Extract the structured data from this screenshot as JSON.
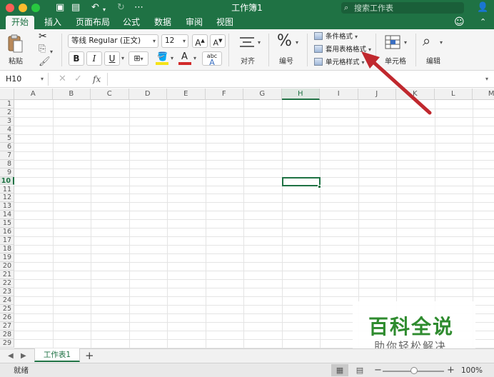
{
  "window": {
    "title": "工作簿1",
    "search_placeholder": "搜索工作表"
  },
  "tabs": [
    {
      "label": "开始",
      "active": true
    },
    {
      "label": "插入"
    },
    {
      "label": "页面布局"
    },
    {
      "label": "公式"
    },
    {
      "label": "数据"
    },
    {
      "label": "审阅"
    },
    {
      "label": "视图"
    }
  ],
  "ribbon": {
    "paste_label": "粘贴",
    "font_name": "等线 Regular (正文)",
    "font_size": "12",
    "bold": "B",
    "italic": "I",
    "underline": "U",
    "font_color_letter": "A",
    "text_label_glyph": "abc",
    "align_label": "对齐",
    "number_label": "编号",
    "styles": {
      "conditional": "条件格式",
      "table_format": "套用表格格式",
      "cell_style": "单元格样式"
    },
    "cells_label": "单元格",
    "editing_label": "编辑",
    "colors": {
      "highlight": "#f5e317",
      "font_color": "#d22a2a"
    }
  },
  "formula_bar": {
    "name_box": "H10",
    "fx": "fx"
  },
  "grid": {
    "columns": [
      "A",
      "B",
      "C",
      "D",
      "E",
      "F",
      "G",
      "H",
      "I",
      "J",
      "K",
      "L",
      "M"
    ],
    "rows": [
      "1",
      "2",
      "3",
      "4",
      "5",
      "6",
      "7",
      "8",
      "9",
      "10",
      "11",
      "12",
      "13",
      "14",
      "15",
      "16",
      "17",
      "18",
      "19",
      "20",
      "21",
      "22",
      "23",
      "24",
      "25",
      "26",
      "27",
      "28",
      "29"
    ],
    "selected_cell": "H10"
  },
  "sheets": {
    "tabs": [
      "工作表1"
    ],
    "add": "+"
  },
  "status": {
    "ready": "就绪",
    "zoom": "100%"
  },
  "watermark": {
    "title": "百科全说",
    "subtitle": "助你轻松解决"
  },
  "accent": "#1f7244"
}
